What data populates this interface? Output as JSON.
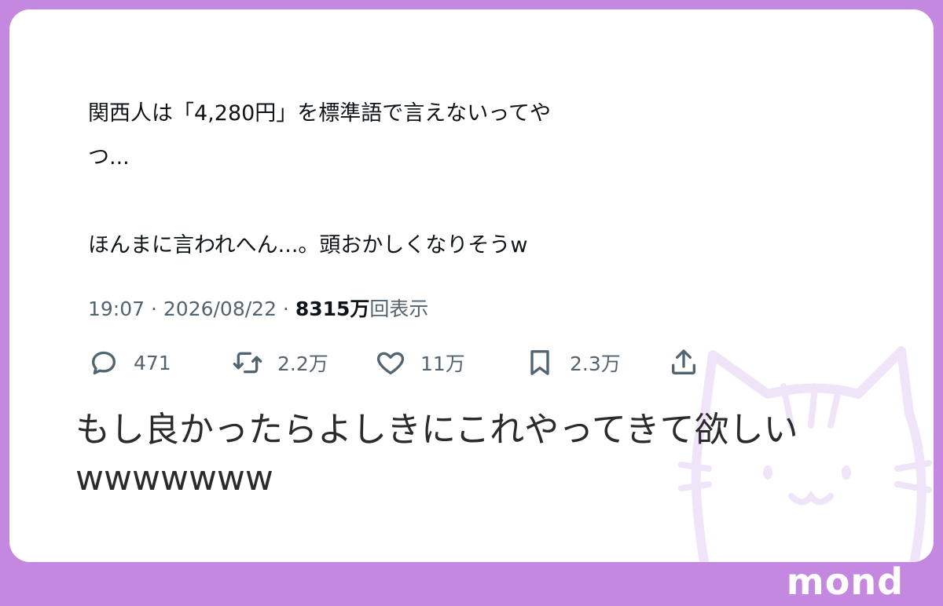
{
  "tweet": {
    "text": "関西人は「4,280円」を標準語で言えないってや\nつ...\n\nほんまに言われへん...。頭おかしくなりそうw",
    "time": "19:07",
    "date": "2026/08/22",
    "views_number": "8315万",
    "views_label": "回表示",
    "separator": " · "
  },
  "actions": {
    "reply": {
      "icon": "reply-icon",
      "count": "471"
    },
    "retweet": {
      "icon": "retweet-icon",
      "count": "2.2万"
    },
    "like": {
      "icon": "heart-icon",
      "count": "11万"
    },
    "bookmark": {
      "icon": "bookmark-icon",
      "count": "2.3万"
    },
    "share": {
      "icon": "share-icon"
    }
  },
  "message": {
    "text": "もし良かったらよしきにこれやってきて欲しい\nwwwwwww"
  },
  "brand": {
    "name": "mond"
  },
  "colors": {
    "frame": "#c488e0",
    "text": "#0f1419",
    "muted": "#536471",
    "watermark": "#f0e4f8"
  }
}
